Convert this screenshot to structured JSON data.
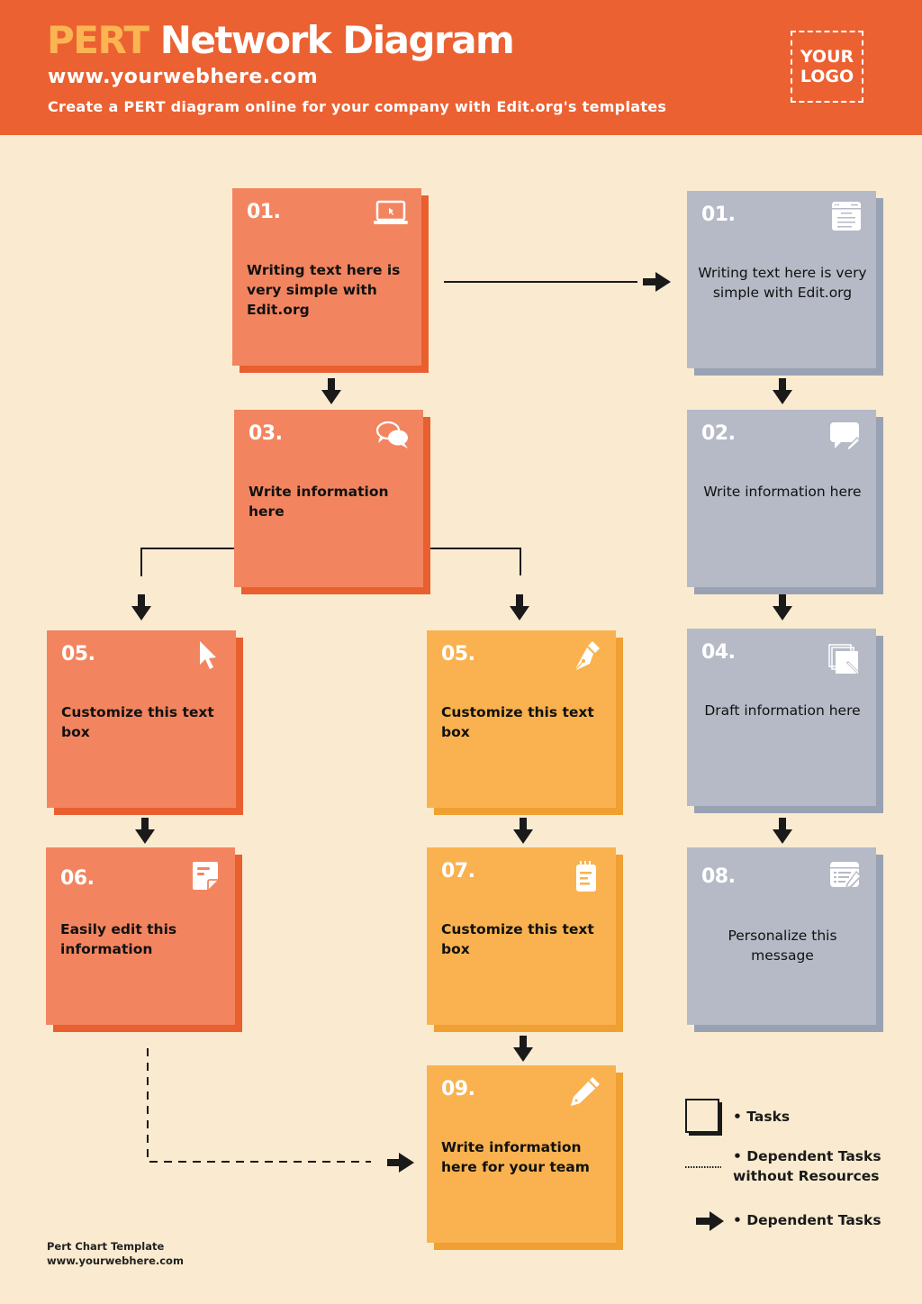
{
  "header": {
    "title_accent": "PERT",
    "title_rest": "Network Diagram",
    "website": "www.yourwebhere.com",
    "subtitle": "Create a PERT diagram online for your company with Edit.org's templates",
    "logo_line1": "YOUR",
    "logo_line2": "LOGO"
  },
  "colors": {
    "header_bg": "#EB6131",
    "page_bg": "#FAEBD0",
    "accent_yellow": "#FBB452",
    "card_red": "#F28560",
    "card_yellow": "#F9B24F",
    "card_gray": "#B5BAC6"
  },
  "cards": [
    {
      "id": "red-01",
      "color": "red",
      "number": "01.",
      "icon": "laptop-icon",
      "text": "Writing text here is very simple with Edit.org"
    },
    {
      "id": "red-03",
      "color": "red",
      "number": "03.",
      "icon": "chat-bubbles-icon",
      "text": "Write information here"
    },
    {
      "id": "red-05",
      "color": "red",
      "number": "05.",
      "icon": "cursor-icon",
      "text": "Customize this text box"
    },
    {
      "id": "red-06",
      "color": "red",
      "number": "06.",
      "icon": "note-icon",
      "text": "Easily edit this information"
    },
    {
      "id": "yellow-05",
      "color": "yellow",
      "number": "05.",
      "icon": "pen-nib-icon",
      "text": "Customize this text box"
    },
    {
      "id": "yellow-07",
      "color": "yellow",
      "number": "07.",
      "icon": "notepad-icon",
      "text": "Customize this text box"
    },
    {
      "id": "yellow-09",
      "color": "yellow",
      "number": "09.",
      "icon": "pencil-icon",
      "text": "Write information here for your team"
    },
    {
      "id": "gray-01",
      "color": "gray",
      "number": "01.",
      "icon": "browser-window-icon",
      "text": "Writing text here is very simple with Edit.org"
    },
    {
      "id": "gray-02",
      "color": "gray",
      "number": "02.",
      "icon": "comment-edit-icon",
      "text": "Write information here"
    },
    {
      "id": "gray-04",
      "color": "gray",
      "number": "04.",
      "icon": "drafts-icon",
      "text": "Draft information here"
    },
    {
      "id": "gray-08",
      "color": "gray",
      "number": "08.",
      "icon": "form-edit-icon",
      "text": "Personalize this message"
    }
  ],
  "legend": {
    "tasks": "• Tasks",
    "dependent_no_resources_line1": "• Dependent Tasks",
    "dependent_no_resources_line2": "without Resources",
    "dependent": "• Dependent Tasks"
  },
  "footer": {
    "line1": "Pert Chart Template",
    "line2": "www.yourwebhere.com"
  }
}
